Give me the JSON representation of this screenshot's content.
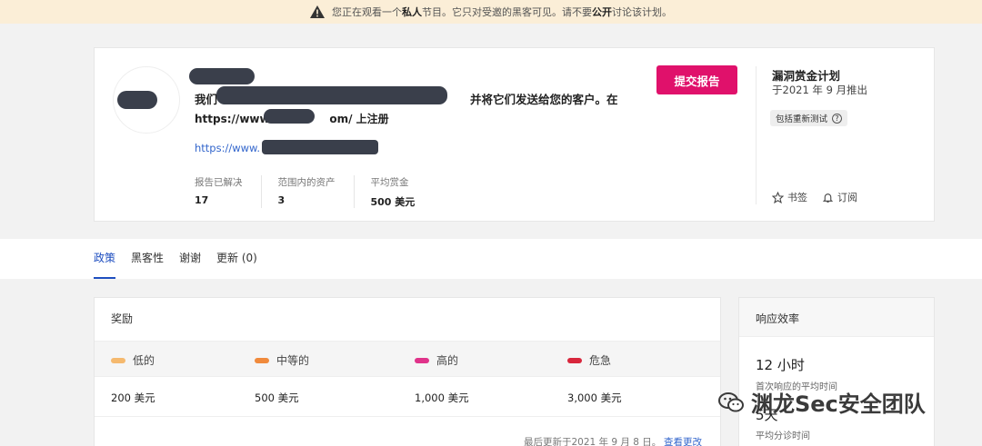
{
  "banner": {
    "text_before": "您正在观看一个",
    "text_private": "私人",
    "text_middle": "节目。它只对受邀的黑客可见。请不要",
    "text_public": "公开",
    "text_after": "讨论该计划。",
    "icon": "warning-icon"
  },
  "program": {
    "desc_start": "我们",
    "desc_end": "并将它们发送给您的客户。在",
    "url_line1_prefix": "https://www.",
    "url_line1_suffix": "om/ 上注册",
    "url_line2_prefix": "https://www.",
    "submit_label": "提交报告",
    "title": "漏洞赏金计划",
    "launched": "于2021 年 9 月推出",
    "retest_badge": "包括重新测试",
    "bookmark_label": "书签",
    "subscribe_label": "订阅",
    "stats": [
      {
        "label": "报告已解决",
        "value": "17"
      },
      {
        "label": "范围内的资产",
        "value": "3"
      },
      {
        "label": "平均赏金",
        "value": "500 美元"
      }
    ]
  },
  "tabs": [
    {
      "label": "政策",
      "active": true
    },
    {
      "label": "黑客性",
      "active": false
    },
    {
      "label": "谢谢",
      "active": false
    },
    {
      "label": "更新 (0)",
      "active": false
    }
  ],
  "rewards": {
    "title": "奖励",
    "severities": [
      {
        "label": "低的",
        "amount": "200 美元",
        "color": "#f5b96e"
      },
      {
        "label": "中等的",
        "amount": "500 美元",
        "color": "#f08a3c"
      },
      {
        "label": "高的",
        "amount": "1,000 美元",
        "color": "#e0338a"
      },
      {
        "label": "危急",
        "amount": "3,000 美元",
        "color": "#d8263c"
      }
    ],
    "updated": "最后更新于2021 年 9 月 8 日。",
    "view_changes": "查看更改"
  },
  "response": {
    "title": "响应效率",
    "first_response_value": "12 小时",
    "first_response_label": "首次响应的平均时间",
    "triage_value": "5天",
    "triage_label": "平均分诊时间"
  },
  "watermark": {
    "text": "渊龙Sec安全团队",
    "icon": "wechat-icon"
  }
}
